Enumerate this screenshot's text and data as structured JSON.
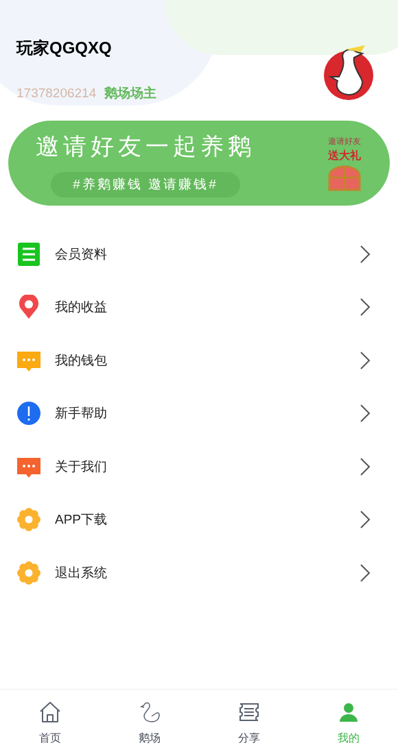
{
  "profile": {
    "name": "玩家QGQXQ",
    "phone": "17378206214",
    "role": "鹅场场主"
  },
  "banner": {
    "title": "邀请好友一起养鹅",
    "subtitle": "#养鹅赚钱 邀请赚钱#",
    "badge_top": "邀请好友",
    "badge_bottom": "送大礼"
  },
  "menu": [
    {
      "label": "会员资料",
      "kind": "list",
      "color": "#19c41e"
    },
    {
      "label": "我的收益",
      "kind": "pin",
      "color": "#f0484a"
    },
    {
      "label": "我的钱包",
      "kind": "chat",
      "color": "#fbaa12"
    },
    {
      "label": "新手帮助",
      "kind": "alert",
      "color": "#1e6cf0"
    },
    {
      "label": "关于我们",
      "kind": "chat",
      "color": "#f5632e"
    },
    {
      "label": "APP下载",
      "kind": "gear",
      "color": "#fbb22e"
    },
    {
      "label": "退出系统",
      "kind": "gear",
      "color": "#fbb22e"
    }
  ],
  "tabs": [
    {
      "label": "首页",
      "kind": "home",
      "selected": false
    },
    {
      "label": "鹅场",
      "kind": "goose",
      "selected": false
    },
    {
      "label": "分享",
      "kind": "ticket",
      "selected": false
    },
    {
      "label": "我的",
      "kind": "person",
      "selected": true
    }
  ]
}
